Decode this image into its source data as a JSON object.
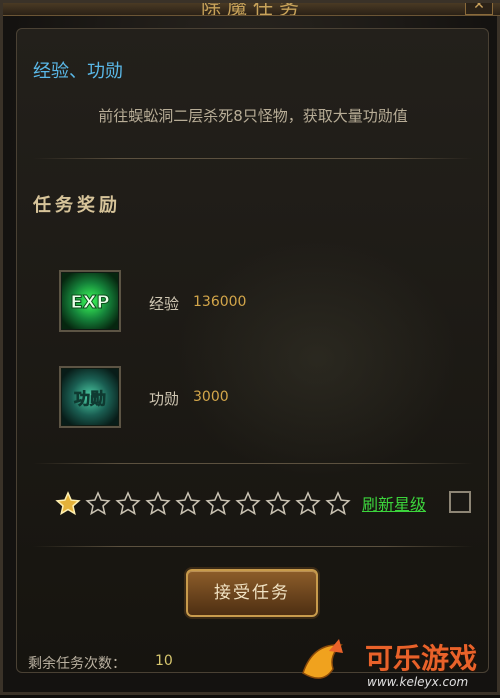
{
  "window": {
    "title": "除魔任务"
  },
  "mission": {
    "title": "经验、功勋",
    "description": "前往蜈蚣洞二层杀死8只怪物，获取大量功勋值"
  },
  "rewards": {
    "heading": "任务奖励",
    "items": [
      {
        "icon": "exp-icon",
        "icon_text": "EXP",
        "label": "经验",
        "value": "136000"
      },
      {
        "icon": "merit-icon",
        "icon_text": "功勋",
        "label": "功勋",
        "value": "3000"
      }
    ]
  },
  "star_rating": {
    "filled": 1,
    "total": 10,
    "refresh_label": "刷新星级"
  },
  "accept_button": {
    "label": "接受任务"
  },
  "remaining": {
    "label": "剩余任务次数：",
    "value": "10"
  },
  "watermark": {
    "text": "可乐游戏",
    "url": "www.keleyx.com"
  },
  "colors": {
    "accent_blue": "#5ab8e8",
    "gold": "#d3a64a",
    "green": "#3cd43c",
    "star_filled": "#e4b23a",
    "star_empty": "#1a1814"
  }
}
